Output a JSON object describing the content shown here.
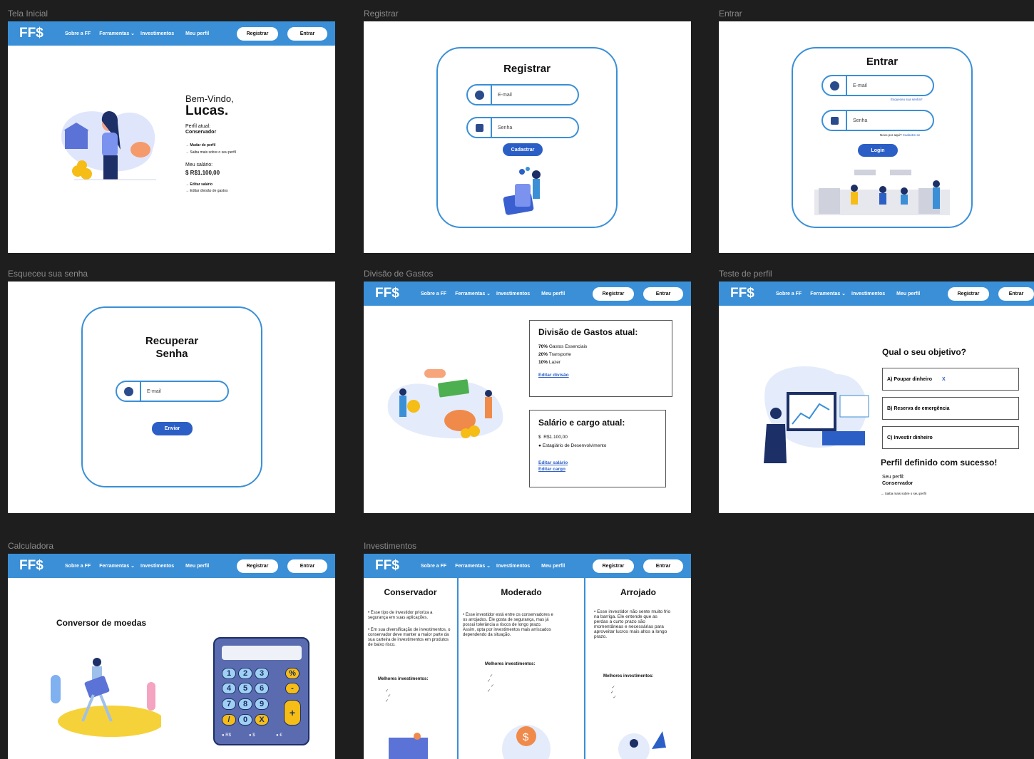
{
  "frames": {
    "home": "Tela Inicial",
    "register": "Registrar",
    "login": "Entrar",
    "forgot": "Esqueceu sua senha",
    "expenses": "Divisão de Gastos",
    "profile_test": "Teste de perfil",
    "calculator": "Calculadora",
    "investments": "Investimentos"
  },
  "nav": {
    "logo": "FF$",
    "about": "Sobre a FF",
    "tools": "Ferramentas",
    "investments": "Investimentos",
    "profile": "Meu perfil",
    "register": "Registrar",
    "login": "Entrar"
  },
  "home": {
    "welcome": "Bem-Vindo,",
    "name": "Lucas.",
    "profile_label": "Perfil atual:",
    "profile_value": "Conservador",
    "change_profile": "→ Mudar de perfil",
    "learn_profile": "→ Saiba mais sobre o seu perfil",
    "salary_label": "Meu salário:",
    "salary_value": "$ R$1.100,00",
    "edit_salary": "→ Editar salário",
    "edit_division": "→ Editar divisão de gastos"
  },
  "register": {
    "title": "Registrar",
    "email": "E-mail",
    "password": "Senha",
    "submit": "Cadastrar"
  },
  "login": {
    "title": "Entrar",
    "email": "E-mail",
    "forgot": "Esqueceu sua senha?",
    "password": "Senha",
    "no_account": "Novo por aqui?",
    "signup": "Cadastre-se",
    "submit": "Login"
  },
  "forgot": {
    "title_1": "Recuperar",
    "title_2": "Senha",
    "email": "E-mail",
    "submit": "Enviar"
  },
  "expenses": {
    "title": "Divisão de Gastos atual:",
    "lines": [
      {
        "pct": "70%",
        "label": "Gastos Essenciais"
      },
      {
        "pct": "20%",
        "label": "Transporte"
      },
      {
        "pct": "10%",
        "label": "Lazer"
      }
    ],
    "edit_division": "Editar divisão",
    "salary_title": "Salário e cargo atual:",
    "salary": "R$1.100,00",
    "role": "Estagiário de Desenvolvimento",
    "edit_salary": "Editar salário",
    "edit_role": "Editar cargo"
  },
  "profile_test": {
    "question": "Qual o seu objetivo?",
    "options": [
      "A) Poupar dinheiro",
      "B) Reserva de emergência",
      "C) Investir dinheiro"
    ],
    "selected_mark": "X",
    "success": "Perfil definido com sucesso!",
    "your_profile": "Seu perfil:",
    "profile_value": "Conservador",
    "learn_more": "→ Saiba mais sobre o seu perfil"
  },
  "calculator": {
    "title": "Conversor de moedas",
    "keys": [
      "1",
      "2",
      "3",
      "%",
      "4",
      "5",
      "6",
      "-",
      "7",
      "8",
      "9",
      "+",
      "/",
      "0",
      "X"
    ],
    "currencies": [
      "R$",
      "$",
      "€"
    ]
  },
  "investments": {
    "columns": [
      {
        "title": "Conservador",
        "bullets": [
          "Esse tipo de investidor prioriza a segurança em suas aplicações.",
          "Em sua diversificação de investimentos, o conservador deve manter a maior parte da sua carteira de investimentos em produtos de baixo risco."
        ],
        "best": "Melhores investimentos:"
      },
      {
        "title": "Moderado",
        "bullets": [
          "Esse investidor está entre os conservadores e os arrojados. Ele gosta de segurança, mas já possui tolerância a riscos de longo prazo. Assim, opta por investimentos mais arriscados dependendo da situação."
        ],
        "best": "Melhores investimentos:"
      },
      {
        "title": "Arrojado",
        "bullets": [
          "Esse investidor não sente muito frio na barriga. Ele entende que as perdas a curto prazo são momentâneas e necessárias para aproveitar lucros mais altos a longo prazo."
        ],
        "best": "Melhores investimentos:"
      }
    ]
  }
}
